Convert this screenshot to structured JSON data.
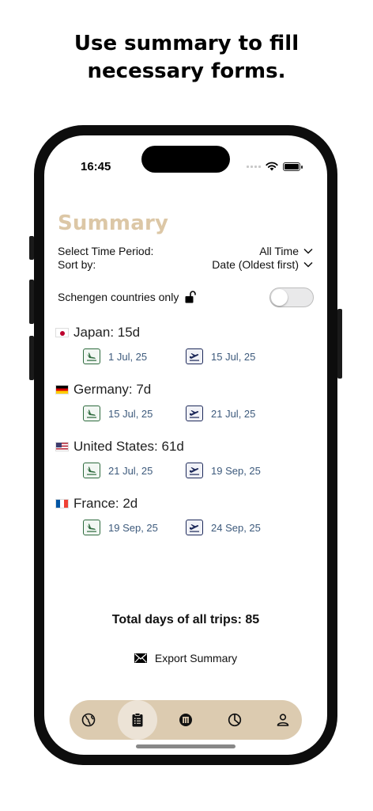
{
  "headline": [
    "Use summary to fill",
    "necessary forms."
  ],
  "status": {
    "time": "16:45"
  },
  "page": {
    "title": "Summary"
  },
  "filters": {
    "period_label": "Select Time Period:",
    "period_value": "All Time",
    "sort_label": "Sort by:",
    "sort_value": "Date (Oldest first)",
    "schengen_label": "Schengen countries only",
    "schengen_on": false
  },
  "trips": [
    {
      "country": "Japan: 15d",
      "flag": "japan-flag",
      "arrival": "1 Jul, 25",
      "departure": "15 Jul, 25"
    },
    {
      "country": "Germany: 7d",
      "flag": "germany-flag",
      "arrival": "15 Jul, 25",
      "departure": "21 Jul, 25"
    },
    {
      "country": "United States: 61d",
      "flag": "usa-flag",
      "arrival": "21 Jul, 25",
      "departure": "19 Sep, 25"
    },
    {
      "country": "France: 2d",
      "flag": "france-flag",
      "arrival": "19 Sep, 25",
      "departure": "24 Sep, 25"
    }
  ],
  "total": "Total days of all trips: 85",
  "export_label": "Export Summary",
  "tabs": [
    {
      "name": "globe-icon",
      "active": false
    },
    {
      "name": "clipboard-icon",
      "active": true
    },
    {
      "name": "passport-icon",
      "active": false
    },
    {
      "name": "pie-chart-icon",
      "active": false
    },
    {
      "name": "person-icon",
      "active": false
    }
  ],
  "colors": {
    "title": "#dcc7a6",
    "tabbar": "#dccbb0",
    "date_text": "#3d5a7c",
    "arrival_icon": "#2e6b3e",
    "departure_icon": "#1e2a5a"
  }
}
